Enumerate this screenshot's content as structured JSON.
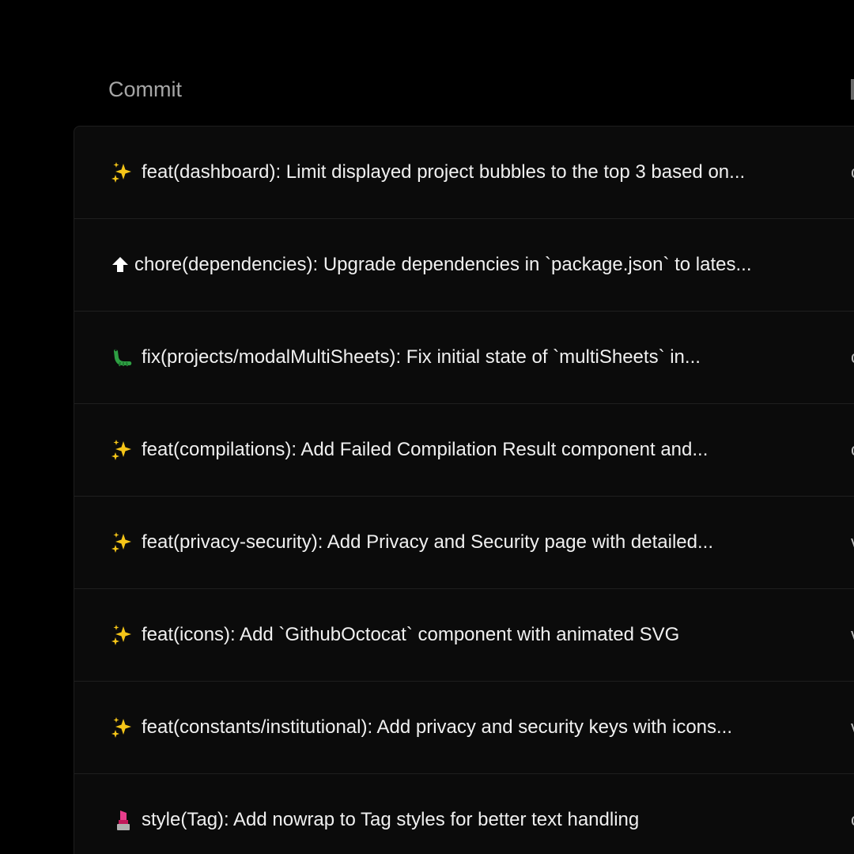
{
  "header": {
    "commit_label": "Commit"
  },
  "colors": {
    "background": "#000000",
    "table_background": "#0b0b0b",
    "row_divider": "#1f1f1f",
    "header_text": "#a6a6a6",
    "row_text": "#f0f0f0",
    "sparkles": "#f5c518",
    "arrow": "#ffffff",
    "bug": "#2ea043",
    "lipstick": "#e83e8c"
  },
  "commits": [
    {
      "icon": "sparkles-icon",
      "message": "feat(dashboard): Limit displayed project bubbles to the top 3 based on...",
      "next_col": "c"
    },
    {
      "icon": "arrow-up-icon",
      "message": "chore(dependencies): Upgrade dependencies in `package.json` to lates...",
      "next_col": ""
    },
    {
      "icon": "bug-icon",
      "message": "fix(projects/modalMultiSheets): Fix initial state of `multiSheets` in...",
      "next_col": "c"
    },
    {
      "icon": "sparkles-icon",
      "message": "feat(compilations): Add Failed Compilation Result component and...",
      "next_col": "c"
    },
    {
      "icon": "sparkles-icon",
      "message": "feat(privacy-security): Add Privacy and Security page with detailed...",
      "next_col": "v"
    },
    {
      "icon": "sparkles-icon",
      "message": "feat(icons): Add `GithubOctocat` component with animated SVG",
      "next_col": "v"
    },
    {
      "icon": "sparkles-icon",
      "message": "feat(constants/institutional): Add privacy and security keys with icons...",
      "next_col": "v"
    },
    {
      "icon": "lipstick-icon",
      "message": "style(Tag): Add nowrap to Tag styles for better text handling",
      "next_col": "c"
    }
  ]
}
